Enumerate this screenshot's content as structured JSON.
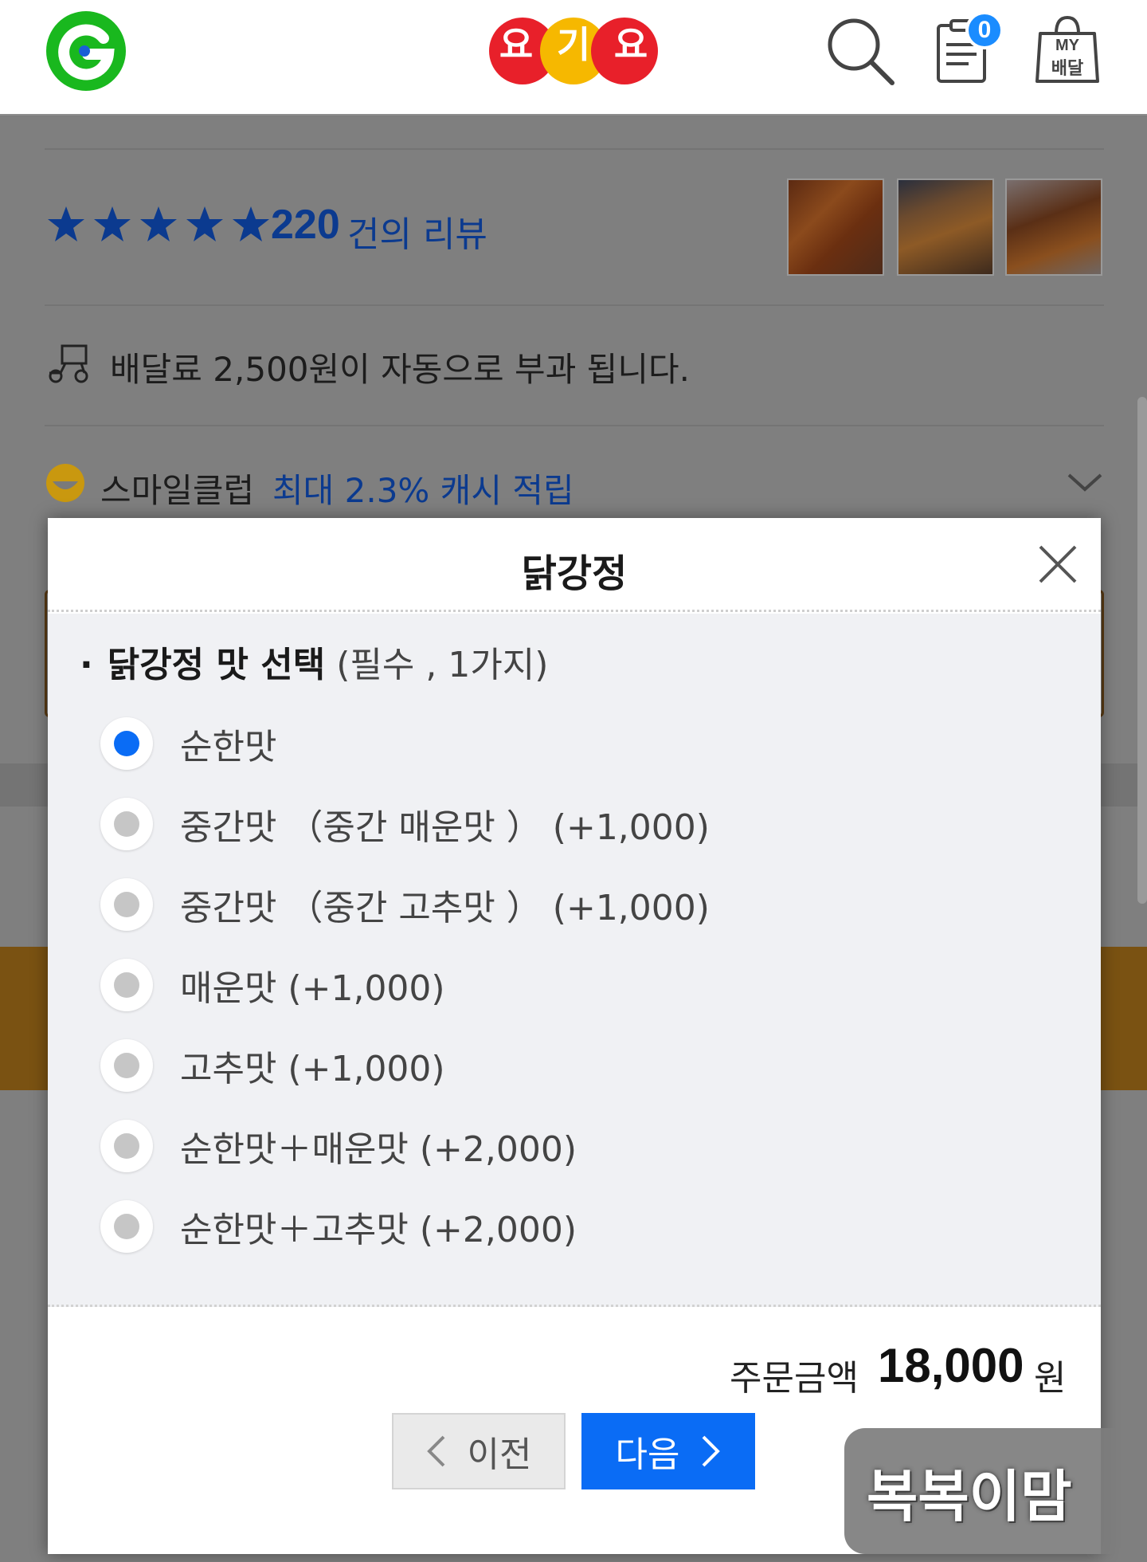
{
  "header": {
    "logo_icon": "gmarket-g-logo",
    "brand_text": [
      "요",
      "기",
      "요"
    ],
    "brand_colors": [
      "#e8202a",
      "#f6b800",
      "#e8202a"
    ],
    "search_icon": "search-icon",
    "cart_icon": "order-list-icon",
    "cart_count": "0",
    "my_icon_line1": "MY",
    "my_icon_line2": "배달"
  },
  "store": {
    "rating_stars": 5,
    "review_count": "220",
    "review_label": "건의 리뷰",
    "delivery_notice": "배달료 2,500원이 자동으로 부과 됩니다.",
    "smile_club_label": "스마일클럽",
    "smile_club_promo": "최대 2.3% 캐시 적립"
  },
  "modal": {
    "title": "닭강정",
    "section_title": "닭강정 맛 선택",
    "section_note": "(필수 , 1가지)",
    "options": [
      {
        "label": "순한맛",
        "checked": true
      },
      {
        "label": "중간맛 （중간 매운맛 ） (+1,000)",
        "checked": false
      },
      {
        "label": "중간맛 （중간 고추맛 ） (+1,000)",
        "checked": false
      },
      {
        "label": "매운맛 (+1,000)",
        "checked": false
      },
      {
        "label": "고추맛 (+1,000)",
        "checked": false
      },
      {
        "label": "순한맛＋매운맛 (+2,000)",
        "checked": false
      },
      {
        "label": "순한맛＋고추맛 (+2,000)",
        "checked": false
      }
    ],
    "total_label": "주문금액",
    "total_value": "18,000",
    "total_unit": "원",
    "prev_label": "이전",
    "next_label": "다음",
    "accent_color": "#0a6cf5"
  },
  "watermark": "복복이맘"
}
